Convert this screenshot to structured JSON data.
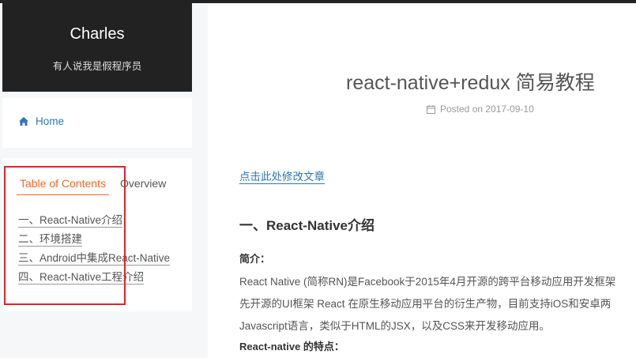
{
  "brand": {
    "title": "Charles",
    "subtitle": "有人说我是假程序员"
  },
  "menu": {
    "home_label": "Home",
    "home_icon": "home-icon"
  },
  "sidebar": {
    "tabs": {
      "toc": "Table of Contents",
      "overview": "Overview"
    },
    "toc_items": [
      "一、React-Native介绍",
      "二、环境搭建",
      "三、Android中集成React-Native",
      "四、React-Native工程介绍"
    ]
  },
  "post": {
    "title": "react-native+redux 简易教程",
    "meta_prefix": "Posted on",
    "date": "2017-09-10",
    "edit_link": "点击此处修改文章",
    "section_title": "一、React-Native介绍",
    "intro_label": "简介：",
    "paragraph_lines": [
      "React Native (简称RN)是Facebook于2015年4月开源的跨平台移动应用开发框架",
      "先开源的UI框架 React 在原生移动应用平台的衍生产物，目前支持iOS和安卓两",
      "Javascript语言，类似于HTML的JSX，以及CSS来开发移动应用。"
    ],
    "features_label": "React-native 的特点："
  },
  "colors": {
    "accent": "#fc6423",
    "link": "#2e77b8",
    "header_bg": "#222222",
    "highlight_box": "#e0242a"
  }
}
